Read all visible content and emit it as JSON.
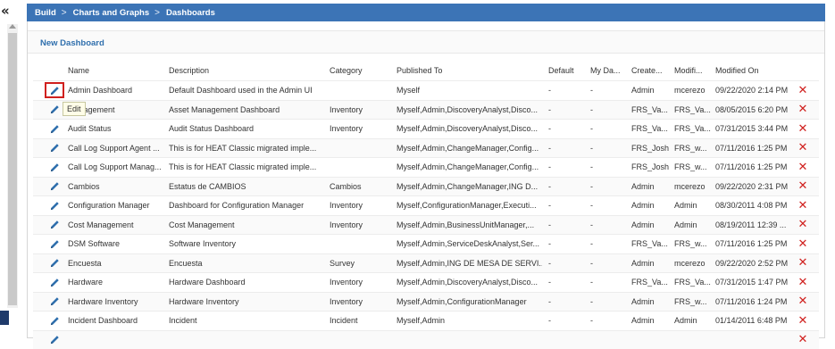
{
  "nav": {
    "collapse_glyph": "«"
  },
  "breadcrumb": [
    {
      "label": "Build"
    },
    {
      "label": "Charts and Graphs"
    },
    {
      "label": "Dashboards"
    }
  ],
  "breadcrumb_sep": ">",
  "toolbar": {
    "new_dashboard_label": "New Dashboard"
  },
  "tooltip": {
    "text": "Edit"
  },
  "colors": {
    "header_bar": "#3c74b6",
    "link": "#2f6fad",
    "delete": "#d0201e",
    "edit_icon": "#2f6fad"
  },
  "icons": {
    "edit": "pencil-icon",
    "delete": "delete-x-icon"
  },
  "columns": {
    "name": "Name",
    "description": "Description",
    "category": "Category",
    "published_to": "Published To",
    "default": "Default",
    "my_dashboard": "My Da...",
    "created_by": "Create...",
    "modified_by": "Modifi...",
    "modified_on": "Modified On"
  },
  "rows": [
    {
      "name": "Admin Dashboard",
      "description": "Default Dashboard used in the Admin UI",
      "category": "",
      "published_to": "Myself",
      "default": "-",
      "my_dashboard": "-",
      "created_by": "Admin",
      "modified_by": "mcerezo",
      "modified_on": "09/22/2020 2:14 PM"
    },
    {
      "name": "Management",
      "description": "Asset Management Dashboard",
      "category": "Inventory",
      "published_to": "Myself,Admin,DiscoveryAnalyst,Disco...",
      "default": "-",
      "my_dashboard": "-",
      "created_by": "FRS_Va...",
      "modified_by": "FRS_Va...",
      "modified_on": "08/05/2015 6:20 PM"
    },
    {
      "name": "Audit Status",
      "description": "Audit Status Dashboard",
      "category": "Inventory",
      "published_to": "Myself,Admin,DiscoveryAnalyst,Disco...",
      "default": "-",
      "my_dashboard": "-",
      "created_by": "FRS_Va...",
      "modified_by": "FRS_Va...",
      "modified_on": "07/31/2015 3:44 PM"
    },
    {
      "name": "Call Log Support Agent ...",
      "description": "This is for HEAT Classic migrated imple...",
      "category": "",
      "published_to": "Myself,Admin,ChangeManager,Config...",
      "default": "-",
      "my_dashboard": "-",
      "created_by": "FRS_Josh",
      "modified_by": "FRS_w...",
      "modified_on": "07/11/2016 1:25 PM"
    },
    {
      "name": "Call Log Support Manag...",
      "description": "This is for HEAT Classic migrated imple...",
      "category": "",
      "published_to": "Myself,Admin,ChangeManager,Config...",
      "default": "-",
      "my_dashboard": "-",
      "created_by": "FRS_Josh",
      "modified_by": "FRS_w...",
      "modified_on": "07/11/2016 1:25 PM"
    },
    {
      "name": "Cambios",
      "description": "Estatus de CAMBIOS",
      "category": "Cambios",
      "published_to": "Myself,Admin,ChangeManager,ING D...",
      "default": "-",
      "my_dashboard": "-",
      "created_by": "Admin",
      "modified_by": "mcerezo",
      "modified_on": "09/22/2020 2:31 PM"
    },
    {
      "name": "Configuration Manager",
      "description": "Dashboard for Configuration Manager",
      "category": "Inventory",
      "published_to": "Myself,ConfigurationManager,Executi...",
      "default": "-",
      "my_dashboard": "-",
      "created_by": "Admin",
      "modified_by": "Admin",
      "modified_on": "08/30/2011 4:08 PM"
    },
    {
      "name": "Cost Management",
      "description": "Cost Management",
      "category": "Inventory",
      "published_to": "Myself,Admin,BusinessUnitManager,...",
      "default": "-",
      "my_dashboard": "-",
      "created_by": "Admin",
      "modified_by": "Admin",
      "modified_on": "08/19/2011 12:39 ..."
    },
    {
      "name": "DSM Software",
      "description": "Software Inventory",
      "category": "",
      "published_to": "Myself,Admin,ServiceDeskAnalyst,Ser...",
      "default": "-",
      "my_dashboard": "-",
      "created_by": "FRS_Va...",
      "modified_by": "FRS_w...",
      "modified_on": "07/11/2016 1:25 PM"
    },
    {
      "name": "Encuesta",
      "description": "Encuesta",
      "category": "Survey",
      "published_to": "Myself,Admin,ING DE MESA DE SERVI...",
      "default": "-",
      "my_dashboard": "-",
      "created_by": "Admin",
      "modified_by": "mcerezo",
      "modified_on": "09/22/2020 2:52 PM"
    },
    {
      "name": "Hardware",
      "description": "Hardware Dashboard",
      "category": "Inventory",
      "published_to": "Myself,Admin,DiscoveryAnalyst,Disco...",
      "default": "-",
      "my_dashboard": "-",
      "created_by": "FRS_Va...",
      "modified_by": "FRS_Va...",
      "modified_on": "07/31/2015 1:47 PM"
    },
    {
      "name": "Hardware Inventory",
      "description": "Hardware Inventory",
      "category": "Inventory",
      "published_to": "Myself,Admin,ConfigurationManager",
      "default": "-",
      "my_dashboard": "-",
      "created_by": "Admin",
      "modified_by": "FRS_w...",
      "modified_on": "07/11/2016 1:24 PM"
    },
    {
      "name": "Incident Dashboard",
      "description": "Incident",
      "category": "Incident",
      "published_to": "Myself,Admin",
      "default": "-",
      "my_dashboard": "-",
      "created_by": "Admin",
      "modified_by": "Admin",
      "modified_on": "01/14/2011 6:48 PM"
    },
    {
      "name": "",
      "description": "",
      "category": "",
      "published_to": "",
      "default": "",
      "my_dashboard": "",
      "created_by": "",
      "modified_by": "",
      "modified_on": ""
    }
  ]
}
